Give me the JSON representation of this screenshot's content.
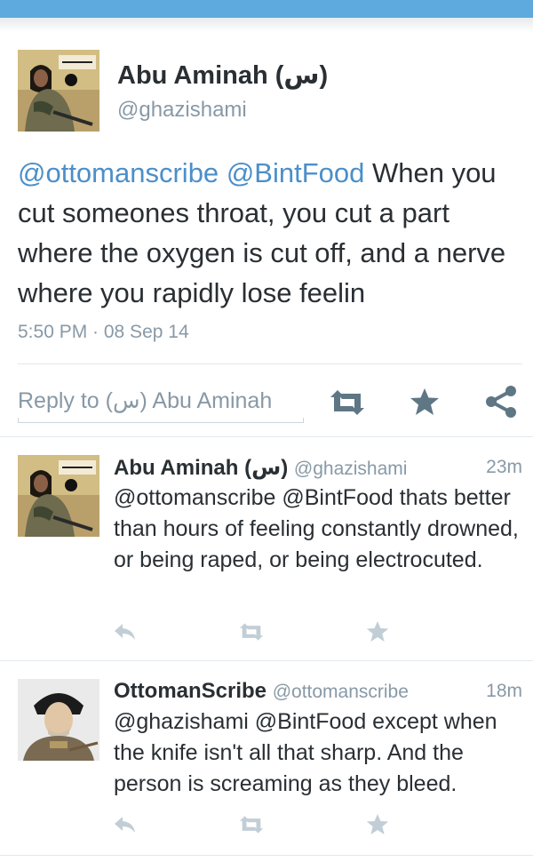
{
  "main_tweet": {
    "name": "Abu Aminah (س)",
    "handle": "@ghazishami",
    "mention1": "@ottomanscribe",
    "mention2": "@BintFood",
    "text": " When you cut someones throat, you cut a part where the oxygen is cut off, and a nerve where you rapidly lose feelin",
    "timestamp": "5:50 PM · 08 Sep 14",
    "reply_placeholder": "Reply to (س) Abu Aminah"
  },
  "replies": [
    {
      "name": "Abu Aminah (س)",
      "handle": "@ghazishami",
      "time": "23m",
      "text": "@ottomanscribe @BintFood thats better than hours of feeling constantly drowned, or being raped, or being electrocuted."
    },
    {
      "name": "OttomanScribe",
      "handle": "@ottomanscribe",
      "time": "18m",
      "text": "@ghazishami @BintFood except when the knife isn't all that sharp. And the person is screaming as they bleed."
    }
  ],
  "icons": {
    "retweet": "retweet-icon",
    "favorite": "star-icon",
    "share": "share-icon",
    "reply": "reply-arrow-icon"
  },
  "colors": {
    "top_bar": "#5ea9dd",
    "mention": "#4b8fc9",
    "secondary_text": "#8899a6",
    "icon_main": "#5f7785",
    "icon_light": "#c2ced6"
  }
}
